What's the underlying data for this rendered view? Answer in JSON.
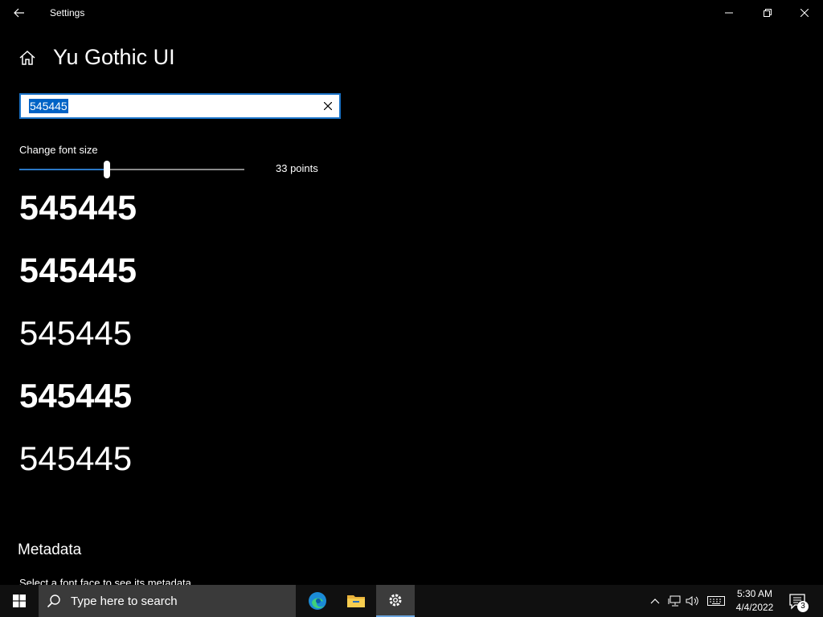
{
  "window": {
    "title": "Settings"
  },
  "header": {
    "title": "Yu Gothic UI"
  },
  "sample_input": {
    "value": "545445"
  },
  "font_size": {
    "label": "Change font size",
    "value_text": "33 points",
    "level": 0.39
  },
  "previews": [
    {
      "text": "545445",
      "weight": "bold"
    },
    {
      "text": "545445",
      "weight": "bold"
    },
    {
      "text": "545445",
      "weight": "light"
    },
    {
      "text": "545445",
      "weight": "semibold"
    },
    {
      "text": "545445",
      "weight": "regular"
    }
  ],
  "metadata": {
    "heading": "Metadata",
    "hint": "Select a font face to see its metadata"
  },
  "taskbar": {
    "search_placeholder": "Type here to search",
    "clock_time": "5:30 AM",
    "clock_date": "4/4/2022",
    "notification_count": "3",
    "apps": [
      "edge-icon",
      "file-explorer-icon",
      "settings-gear-icon"
    ],
    "accent_color": "#6ba5df"
  },
  "colors": {
    "background": "#000000",
    "accent": "#0063c6",
    "slider_fill": "#2b78c5"
  }
}
